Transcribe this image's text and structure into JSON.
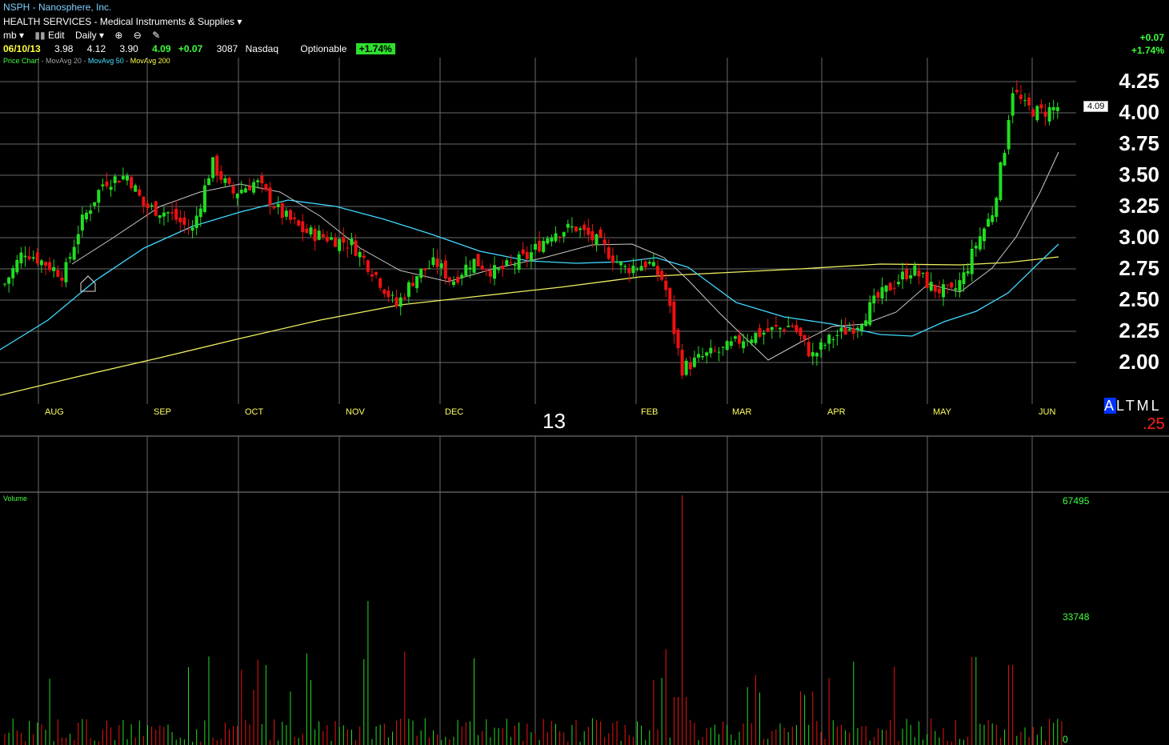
{
  "header": {
    "symbol_title": "NSPH - Nanosphere, Inc.",
    "industry": "HEALTH SERVICES - Medical Instruments & Supplies",
    "menu": {
      "user": "mb",
      "edit": "Edit",
      "period": "Daily"
    },
    "quote": {
      "date": "06/10/13",
      "open": "3.98",
      "high": "4.12",
      "low": "3.90",
      "last": "4.09",
      "change": "+0.07",
      "volume": "3087",
      "exchange": "Nasdaq",
      "optionable": "Optionable",
      "pct_badge": "+1.74%"
    },
    "legend": {
      "price": "Price Chart",
      "ma20": "MovAvg 20",
      "ma50": "MovAvg 50",
      "ma200": "MovAvg 200"
    },
    "right_change": "+0.07",
    "right_pct": "+1.74%"
  },
  "price_axis": {
    "labels": [
      "4.25",
      "4.00",
      "3.75",
      "3.50",
      "3.25",
      "3.00",
      "2.75",
      "2.50",
      "2.25",
      "2.00"
    ],
    "last_label": "4.09"
  },
  "months": [
    "AUG",
    "SEP",
    "OCT",
    "NOV",
    "DEC",
    "FEB",
    "MAR",
    "APR",
    "MAY",
    "JUN"
  ],
  "year_label": "13",
  "tool": {
    "letters_selected": "A",
    "letters_rest": "LTML",
    "value": ".25"
  },
  "volume_panel": {
    "label": "Volume",
    "ticks": [
      "67495",
      "33748",
      "0"
    ]
  },
  "colors": {
    "up": "#22dd22",
    "down": "#ee1111",
    "ma20": "#c8c8c8",
    "ma50": "#40d8ff",
    "ma200": "#f0f060",
    "grid": "#6a6a6a"
  }
}
